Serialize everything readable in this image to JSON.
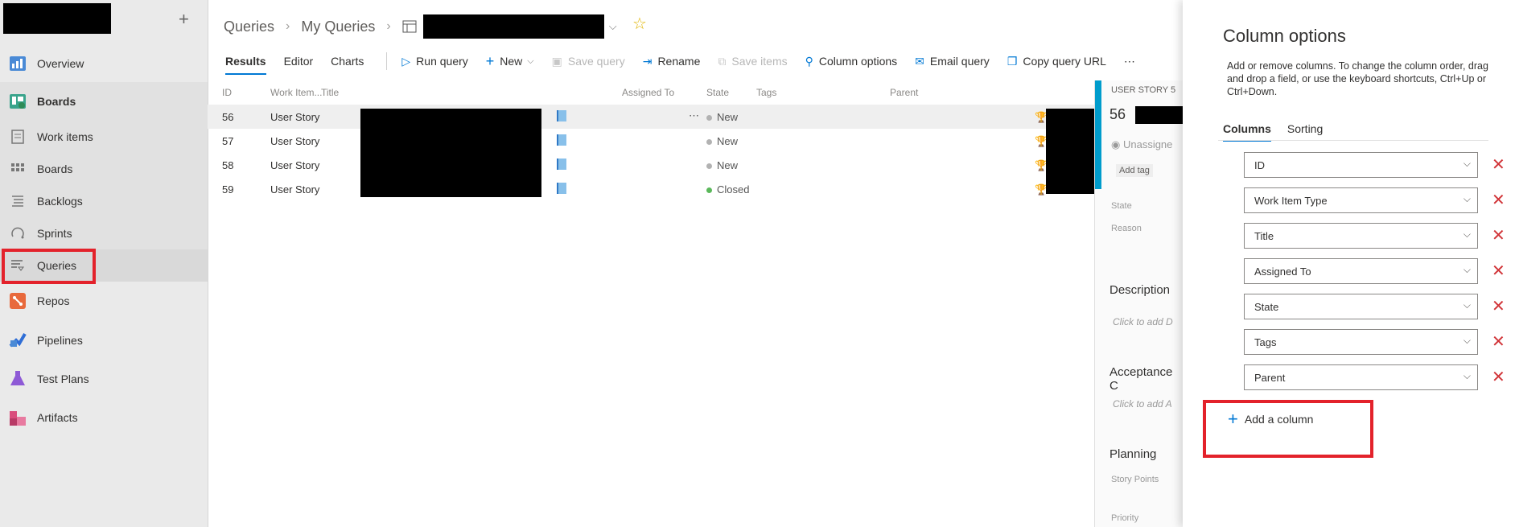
{
  "sidebar": {
    "items": [
      {
        "label": "Overview"
      },
      {
        "label": "Boards"
      },
      {
        "label": "Work items"
      },
      {
        "label": "Boards"
      },
      {
        "label": "Backlogs"
      },
      {
        "label": "Sprints"
      },
      {
        "label": "Queries"
      },
      {
        "label": "Repos"
      },
      {
        "label": "Pipelines"
      },
      {
        "label": "Test Plans"
      },
      {
        "label": "Artifacts"
      }
    ]
  },
  "header": {
    "breadcrumb": [
      "Queries",
      "My Queries"
    ]
  },
  "toolbar": {
    "tabs": [
      "Results",
      "Editor",
      "Charts"
    ],
    "commands": {
      "run_query": "Run query",
      "new": "New",
      "save_query": "Save query",
      "rename": "Rename",
      "save_items": "Save items",
      "column_options": "Column options",
      "email_query": "Email query",
      "copy_query_url": "Copy query URL",
      "more": "⋯"
    }
  },
  "grid": {
    "headers": {
      "id": "ID",
      "type": "Work Item...",
      "title": "Title",
      "assigned": "Assigned To",
      "state": "State",
      "tags": "Tags",
      "parent": "Parent"
    },
    "rows": [
      {
        "id": "56",
        "type": "User Story",
        "state": "New",
        "state_color": "#b2b2b2",
        "more": "⋯"
      },
      {
        "id": "57",
        "type": "User Story",
        "state": "New",
        "state_color": "#b2b2b2"
      },
      {
        "id": "58",
        "type": "User Story",
        "state": "New",
        "state_color": "#b2b2b2"
      },
      {
        "id": "59",
        "type": "User Story",
        "state": "Closed",
        "state_color": "#5bb85b"
      }
    ]
  },
  "peek": {
    "type_label": "USER STORY 5",
    "id": "56",
    "assignee": "Unassigne",
    "add_tag": "Add tag",
    "state_label": "State",
    "reason_label": "Reason",
    "description": "Description",
    "desc_placeholder": "Click to add D",
    "acceptance": "Acceptance C",
    "acc_placeholder": "Click to add A",
    "planning": "Planning",
    "story_points": "Story Points",
    "priority": "Priority"
  },
  "panel": {
    "title": "Column options",
    "description": "Add or remove columns. To change the column order, drag and drop a field, or use the keyboard shortcuts, Ctrl+Up or Ctrl+Down.",
    "tabs": [
      "Columns",
      "Sorting"
    ],
    "columns": [
      "ID",
      "Work Item Type",
      "Title",
      "Assigned To",
      "State",
      "Tags",
      "Parent"
    ],
    "add_column": "Add a column"
  },
  "colors": {
    "accent": "#0078d4",
    "highlight": "#e3222b",
    "remove": "#d13438"
  }
}
